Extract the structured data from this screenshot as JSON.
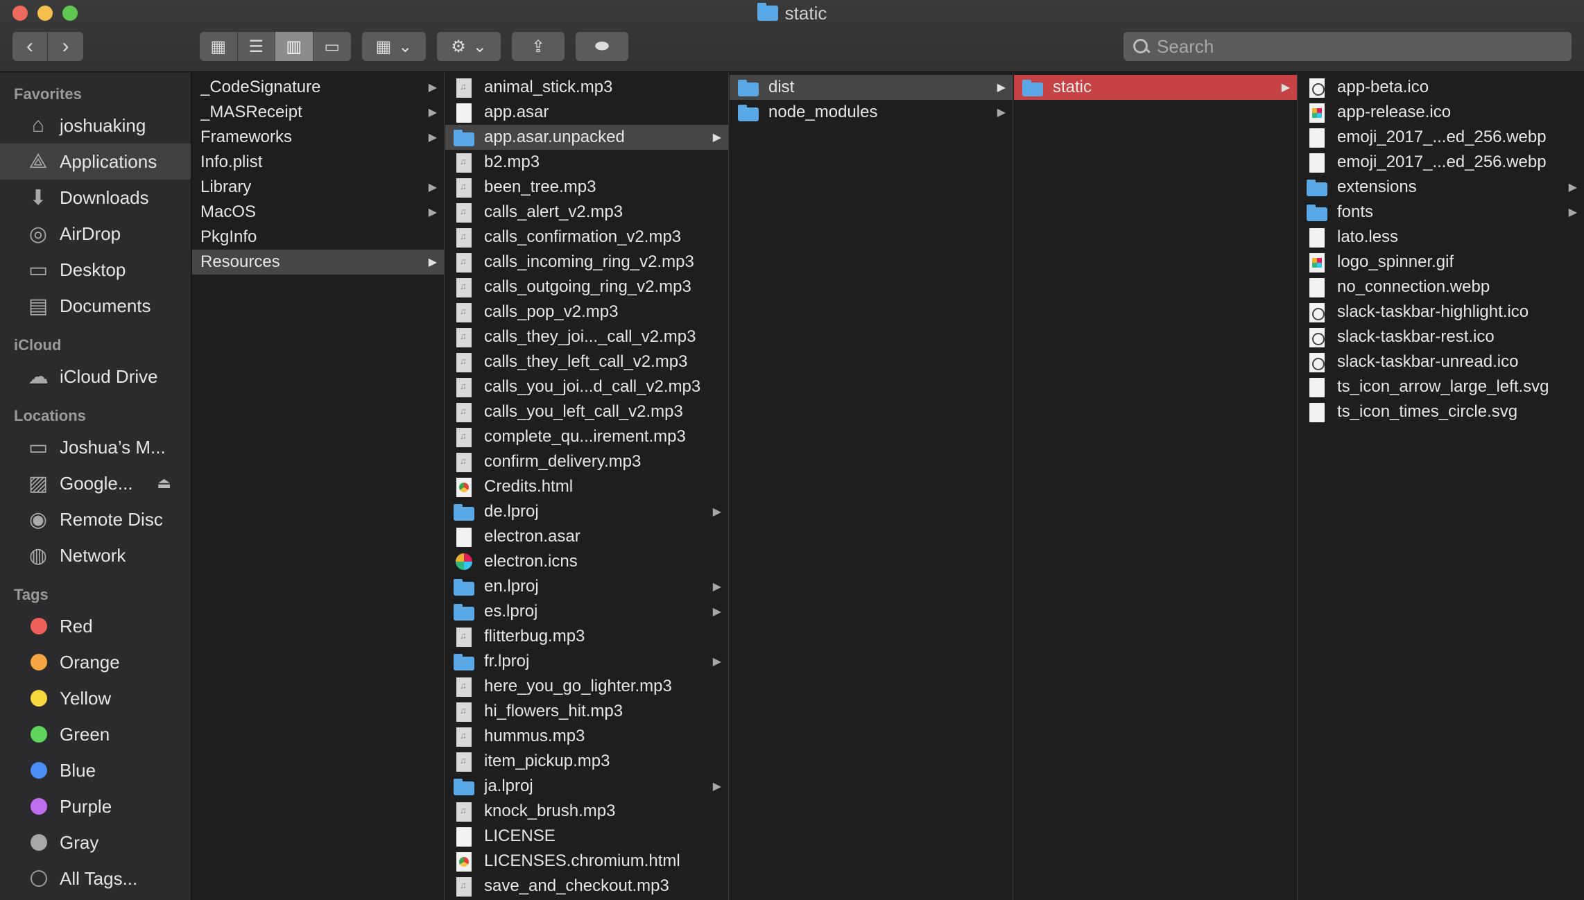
{
  "window": {
    "title": "static"
  },
  "toolbar": {
    "back_label": "‹",
    "forward_label": "›",
    "view_icons_label": "▦",
    "view_list_label": "☰",
    "view_columns_label": "▥",
    "view_gallery_label": "▭",
    "arrange_label": "▦",
    "action_label": "⚙",
    "share_label": "⇪",
    "tag_label": "⬬",
    "dropdown_glyph": "⌄"
  },
  "search": {
    "placeholder": "Search",
    "value": ""
  },
  "sidebar": {
    "favorites_title": "Favorites",
    "favorites": [
      {
        "label": "joshuaking",
        "icon": "home-icon"
      },
      {
        "label": "Applications",
        "icon": "applications-icon"
      },
      {
        "label": "Downloads",
        "icon": "downloads-icon"
      },
      {
        "label": "AirDrop",
        "icon": "airdrop-icon"
      },
      {
        "label": "Desktop",
        "icon": "desktop-icon"
      },
      {
        "label": "Documents",
        "icon": "documents-icon"
      }
    ],
    "icloud_title": "iCloud",
    "icloud": [
      {
        "label": "iCloud Drive",
        "icon": "cloud-icon"
      }
    ],
    "locations_title": "Locations",
    "locations": [
      {
        "label": "Joshua’s M...",
        "icon": "laptop-icon"
      },
      {
        "label": "Google...",
        "icon": "drive-icon"
      },
      {
        "label": "Remote Disc",
        "icon": "disc-icon"
      },
      {
        "label": "Network",
        "icon": "network-icon"
      }
    ],
    "tags_title": "Tags",
    "tags": [
      {
        "label": "Red",
        "color": "#f0605a"
      },
      {
        "label": "Orange",
        "color": "#f5a543"
      },
      {
        "label": "Yellow",
        "color": "#f7d93e"
      },
      {
        "label": "Green",
        "color": "#5fd35b"
      },
      {
        "label": "Blue",
        "color": "#4a8ff6"
      },
      {
        "label": "Purple",
        "color": "#c06ef0"
      },
      {
        "label": "Gray",
        "color": "#a7a7a7"
      },
      {
        "label": "All Tags..."
      }
    ]
  },
  "columns": {
    "col1": [
      {
        "name": "_CodeSignature",
        "arrow": true
      },
      {
        "name": "_MASReceipt",
        "arrow": true
      },
      {
        "name": "Frameworks",
        "arrow": true
      },
      {
        "name": "Info.plist"
      },
      {
        "name": "Library",
        "arrow": true
      },
      {
        "name": "MacOS",
        "arrow": true
      },
      {
        "name": "PkgInfo"
      },
      {
        "name": "Resources",
        "arrow": true,
        "selected": "gray"
      }
    ],
    "col2": [
      {
        "name": "animal_stick.mp3",
        "type": "audio"
      },
      {
        "name": "app.asar",
        "type": "doc"
      },
      {
        "name": "app.asar.unpacked",
        "type": "folder",
        "arrow": true,
        "selected": "gray"
      },
      {
        "name": "b2.mp3",
        "type": "audio"
      },
      {
        "name": "been_tree.mp3",
        "type": "audio"
      },
      {
        "name": "calls_alert_v2.mp3",
        "type": "audio"
      },
      {
        "name": "calls_confirmation_v2.mp3",
        "type": "audio"
      },
      {
        "name": "calls_incoming_ring_v2.mp3",
        "type": "audio"
      },
      {
        "name": "calls_outgoing_ring_v2.mp3",
        "type": "audio"
      },
      {
        "name": "calls_pop_v2.mp3",
        "type": "audio"
      },
      {
        "name": "calls_they_joi..._call_v2.mp3",
        "type": "audio"
      },
      {
        "name": "calls_they_left_call_v2.mp3",
        "type": "audio"
      },
      {
        "name": "calls_you_joi...d_call_v2.mp3",
        "type": "audio"
      },
      {
        "name": "calls_you_left_call_v2.mp3",
        "type": "audio"
      },
      {
        "name": "complete_qu...irement.mp3",
        "type": "audio"
      },
      {
        "name": "confirm_delivery.mp3",
        "type": "audio"
      },
      {
        "name": "Credits.html",
        "type": "html"
      },
      {
        "name": "de.lproj",
        "type": "folder",
        "arrow": true
      },
      {
        "name": "electron.asar",
        "type": "doc"
      },
      {
        "name": "electron.icns",
        "type": "icns"
      },
      {
        "name": "en.lproj",
        "type": "folder",
        "arrow": true
      },
      {
        "name": "es.lproj",
        "type": "folder",
        "arrow": true
      },
      {
        "name": "flitterbug.mp3",
        "type": "audio"
      },
      {
        "name": "fr.lproj",
        "type": "folder",
        "arrow": true
      },
      {
        "name": "here_you_go_lighter.mp3",
        "type": "audio"
      },
      {
        "name": "hi_flowers_hit.mp3",
        "type": "audio"
      },
      {
        "name": "hummus.mp3",
        "type": "audio"
      },
      {
        "name": "item_pickup.mp3",
        "type": "audio"
      },
      {
        "name": "ja.lproj",
        "type": "folder",
        "arrow": true
      },
      {
        "name": "knock_brush.mp3",
        "type": "audio"
      },
      {
        "name": "LICENSE",
        "type": "doc"
      },
      {
        "name": "LICENSES.chromium.html",
        "type": "html"
      },
      {
        "name": "save_and_checkout.mp3",
        "type": "audio"
      }
    ],
    "col3": [
      {
        "name": "dist",
        "type": "folder",
        "arrow": true,
        "selected": "gray"
      },
      {
        "name": "node_modules",
        "type": "folder",
        "arrow": true
      }
    ],
    "col4": [
      {
        "name": "static",
        "type": "folder",
        "arrow": true,
        "selected": "red"
      }
    ],
    "col5": [
      {
        "name": "app-beta.ico",
        "type": "ico"
      },
      {
        "name": "app-release.ico",
        "type": "gif"
      },
      {
        "name": "emoji_2017_...ed_256.webp",
        "type": "doc"
      },
      {
        "name": "emoji_2017_...ed_256.webp",
        "type": "doc"
      },
      {
        "name": "extensions",
        "type": "folder",
        "arrow": true
      },
      {
        "name": "fonts",
        "type": "folder",
        "arrow": true
      },
      {
        "name": "lato.less",
        "type": "doc"
      },
      {
        "name": "logo_spinner.gif",
        "type": "gif"
      },
      {
        "name": "no_connection.webp",
        "type": "doc"
      },
      {
        "name": "slack-taskbar-highlight.ico",
        "type": "ico"
      },
      {
        "name": "slack-taskbar-rest.ico",
        "type": "ico"
      },
      {
        "name": "slack-taskbar-unread.ico",
        "type": "ico"
      },
      {
        "name": "ts_icon_arrow_large_left.svg",
        "type": "doc"
      },
      {
        "name": "ts_icon_times_circle.svg",
        "type": "doc"
      }
    ]
  }
}
